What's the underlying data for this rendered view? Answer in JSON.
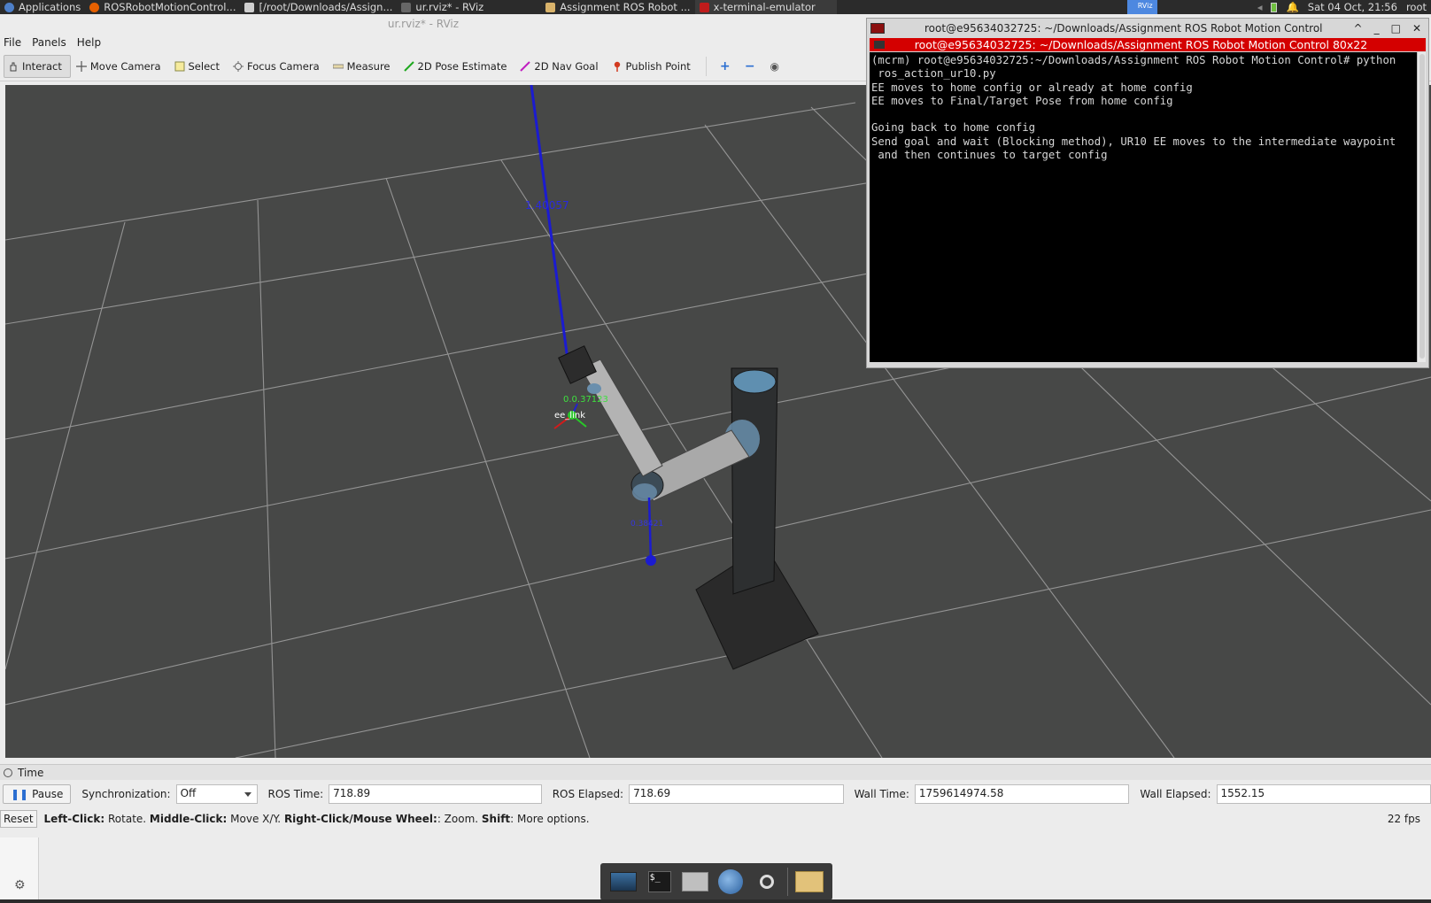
{
  "taskbar": {
    "applications_label": "Applications",
    "tasks": [
      {
        "label": "ROSRobotMotionControl..."
      },
      {
        "label": "[/root/Downloads/Assign..."
      },
      {
        "label": "ur.rviz* - RViz"
      },
      {
        "label": "Assignment ROS Robot ..."
      },
      {
        "label": "x-terminal-emulator"
      }
    ],
    "tray_app_label": "RViz",
    "clock": "Sat 04 Oct, 21:56",
    "user": "root"
  },
  "rviz": {
    "window_title": "ur.rviz* - RViz",
    "menu": [
      "File",
      "Panels",
      "Help"
    ],
    "tools": [
      {
        "label": "Interact",
        "icon": "hand-icon",
        "active": true
      },
      {
        "label": "Move Camera",
        "icon": "move-camera-icon"
      },
      {
        "label": "Select",
        "icon": "select-icon"
      },
      {
        "label": "Focus Camera",
        "icon": "focus-camera-icon"
      },
      {
        "label": "Measure",
        "icon": "ruler-icon"
      },
      {
        "label": "2D Pose Estimate",
        "icon": "pose-estimate-icon",
        "color": "#1fa81f"
      },
      {
        "label": "2D Nav Goal",
        "icon": "nav-goal-icon",
        "color": "#c01fc0"
      },
      {
        "label": "Publish Point",
        "icon": "map-pin-icon",
        "color": "#d23a1f"
      }
    ],
    "scene": {
      "labels": {
        "top_distance": "1.40057",
        "mid_distance": "0.0.37123",
        "ee_link": "ee_link",
        "bottom_distance": "0.38421"
      }
    },
    "time_panel": {
      "title": "Time",
      "pause_label": "Pause",
      "sync_label": "Synchronization:",
      "sync_value": "Off",
      "ros_time_label": "ROS Time:",
      "ros_time": "718.89",
      "ros_elapsed_label": "ROS Elapsed:",
      "ros_elapsed": "718.69",
      "wall_time_label": "Wall Time:",
      "wall_time": "1759614974.58",
      "wall_elapsed_label": "Wall Elapsed:",
      "wall_elapsed": "1552.15"
    },
    "status": {
      "reset_label": "Reset",
      "help_parts": [
        {
          "b": "Left-Click:",
          "t": " Rotate. "
        },
        {
          "b": "Middle-Click:",
          "t": " Move X/Y. "
        },
        {
          "b": "Right-Click/Mouse Wheel:",
          "t": ": Zoom. "
        },
        {
          "b": "Shift",
          "t": ": More options."
        }
      ],
      "fps": "22 fps"
    }
  },
  "terminal": {
    "title": "root@e95634032725: ~/Downloads/Assignment ROS Robot Motion Control",
    "tab_title": "root@e95634032725: ~/Downloads/Assignment ROS Robot Motion Control 80x22",
    "lines": [
      "(mcrm) root@e95634032725:~/Downloads/Assignment ROS Robot Motion Control# python",
      " ros_action_ur10.py",
      "EE moves to home config or already at home config",
      "EE moves to Final/Target Pose from home config",
      "",
      "Going back to home config",
      "Send goal and wait (Blocking method), UR10 EE moves to the intermediate waypoint",
      " and then continues to target config"
    ]
  },
  "colors": {
    "viewport_bg": "#474847",
    "grid": "#a0a0a0",
    "terminal_tab": "#d40000",
    "tray_app": "#4d88e0"
  }
}
